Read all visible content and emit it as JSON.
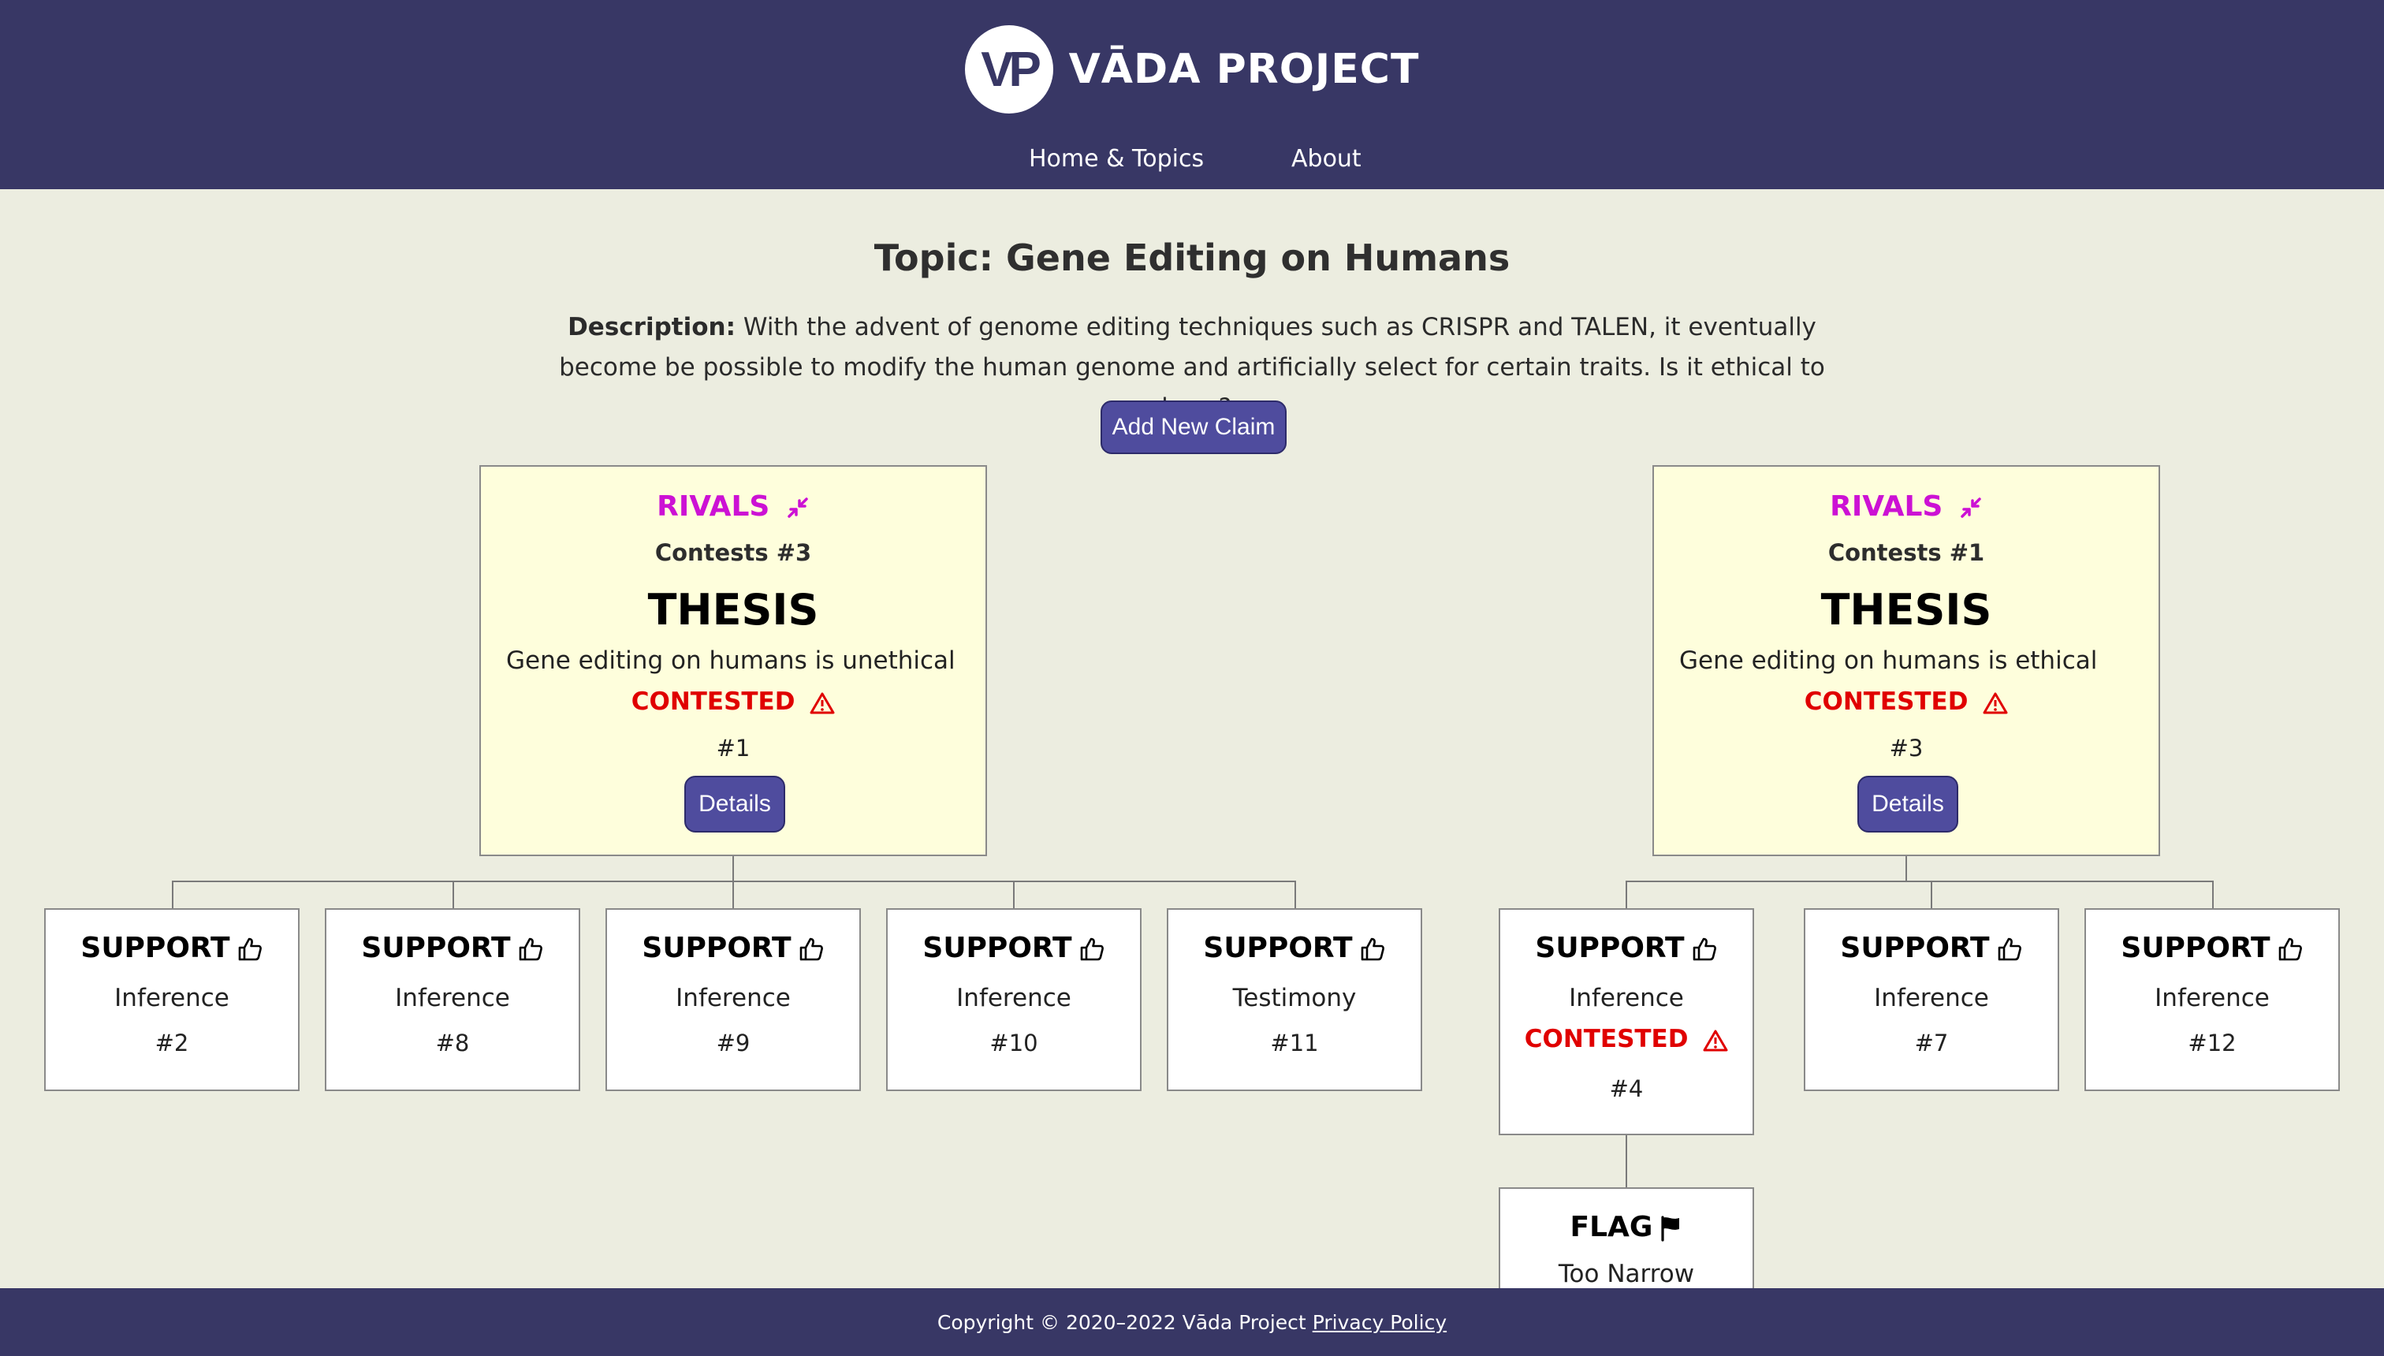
{
  "brand": {
    "logo_letters": "VP",
    "name": "VĀDA PROJECT"
  },
  "nav": {
    "home": "Home & Topics",
    "about": "About"
  },
  "topic": {
    "title": "Topic: Gene Editing on Humans",
    "description_label": "Description:",
    "description": "With the advent of genome editing techniques such as CRISPR and TALEN, it eventually become be possible to modify the human genome and artificially select for certain traits. Is it ethical to do so?"
  },
  "add_claim_label": "Add New Claim",
  "theses": [
    {
      "rivals": "RIVALS",
      "contests": "Contests #3",
      "label": "THESIS",
      "claim": "Gene editing on humans is unethical",
      "status": "CONTESTED",
      "number": "#1",
      "details_label": "Details"
    },
    {
      "rivals": "RIVALS",
      "contests": "Contests #1",
      "label": "THESIS",
      "claim": "Gene editing on humans is ethical",
      "status": "CONTESTED",
      "number": "#3",
      "details_label": "Details"
    }
  ],
  "left_children": [
    {
      "kind": "SUPPORT",
      "sub": "Inference",
      "number": "#2"
    },
    {
      "kind": "SUPPORT",
      "sub": "Inference",
      "number": "#8"
    },
    {
      "kind": "SUPPORT",
      "sub": "Inference",
      "number": "#9"
    },
    {
      "kind": "SUPPORT",
      "sub": "Inference",
      "number": "#10"
    },
    {
      "kind": "SUPPORT",
      "sub": "Testimony",
      "number": "#11"
    }
  ],
  "right_children": [
    {
      "kind": "SUPPORT",
      "sub": "Inference",
      "status": "CONTESTED",
      "number": "#4"
    },
    {
      "kind": "SUPPORT",
      "sub": "Inference",
      "number": "#7"
    },
    {
      "kind": "SUPPORT",
      "sub": "Inference",
      "number": "#12"
    }
  ],
  "flag": {
    "kind": "FLAG",
    "sub": "Too Narrow"
  },
  "footer": {
    "copyright": "Copyright © 2020–2022 Vāda Project",
    "privacy": "Privacy Policy"
  },
  "colors": {
    "header": "#383765",
    "background": "#ecede0",
    "rivals": "#cc11d4",
    "contested": "#e00000",
    "button": "#4f4c9e",
    "thesis_bg": "#fefedc"
  }
}
